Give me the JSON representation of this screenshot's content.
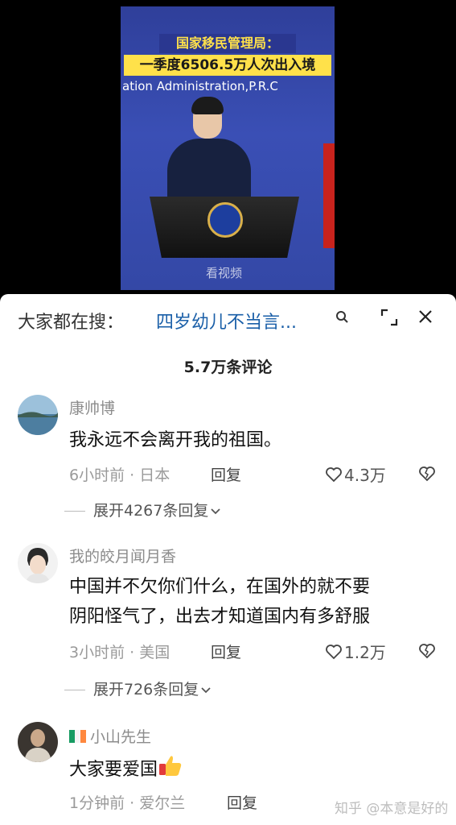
{
  "video": {
    "title_line1": "国家移民管理局：",
    "title_line2": "一季度6506.5万人次出入境",
    "subtitle": "ation Administration,P.R.C",
    "watermark": "看视频"
  },
  "search": {
    "prefix": "大家都在搜：",
    "query": "四岁幼儿不当言..."
  },
  "comment_count": "5.7万条评论",
  "comments": [
    {
      "author": "康帅博",
      "text": "我永远不会离开我的祖国。",
      "time": "6小时前 · 日本",
      "reply_label": "回复",
      "likes": "4.3万",
      "expand": "展开4267条回复"
    },
    {
      "author": "我的皎月闻月香",
      "text_line1": "中国并不欠你们什么，在国外的就不要",
      "text_line2": "阴阳怪气了，出去才知道国内有多舒服",
      "time": "3小时前 · 美国",
      "reply_label": "回复",
      "likes": "1.2万",
      "expand": "展开726条回复"
    },
    {
      "author": "小山先生",
      "text": "大家要爱国",
      "time": "1分钟前 · 爱尔兰",
      "reply_label": "回复"
    }
  ],
  "site_watermark": "知乎 @本意是好的",
  "colors": {
    "accent_link": "#1a5fa8",
    "video_bg": "#3a4fb5",
    "caption_yellow": "#ffe14a"
  }
}
